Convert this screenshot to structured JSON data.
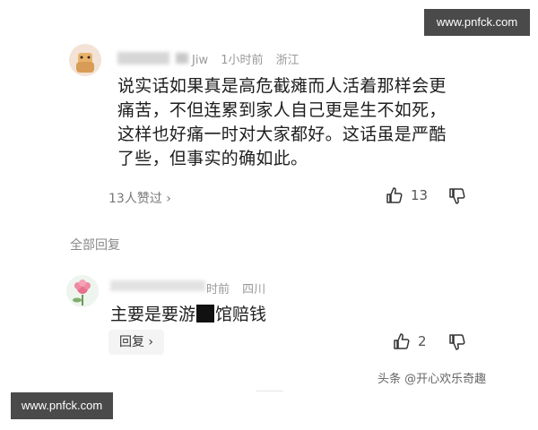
{
  "watermarks": {
    "top": "www.pnfck.com",
    "bottom": "www.pnfck.com"
  },
  "comment": {
    "username_suffix": "Jiw",
    "time": "1小时前",
    "location": "浙江",
    "text_lines": [
      "说实话如果真是高危截瘫而人活着那样会更",
      "痛苦，不但连累到家人自己更是生不如死，",
      "这样也好痛一时对大家都好。这话虽是严酷",
      "了些，但事实的确如此。"
    ],
    "likes_link": "13人赞过",
    "likes_chevron": "›",
    "like_count": "13",
    "like_icon": "thumbs-up-icon",
    "dislike_icon": "thumbs-down-icon"
  },
  "replies_section": {
    "title": "全部回复"
  },
  "reply": {
    "time": "时前",
    "location": "四川",
    "text_before": "主要是要游",
    "text_after": "馆赔钱",
    "reply_button": "回复",
    "reply_chevron": "›",
    "like_count": "2"
  },
  "source_credit": "头条 @开心欢乐奇趣",
  "colors": {
    "watermark_bg": "#4a4a4a",
    "text_primary": "#1e1e1e",
    "text_secondary": "#999999"
  }
}
